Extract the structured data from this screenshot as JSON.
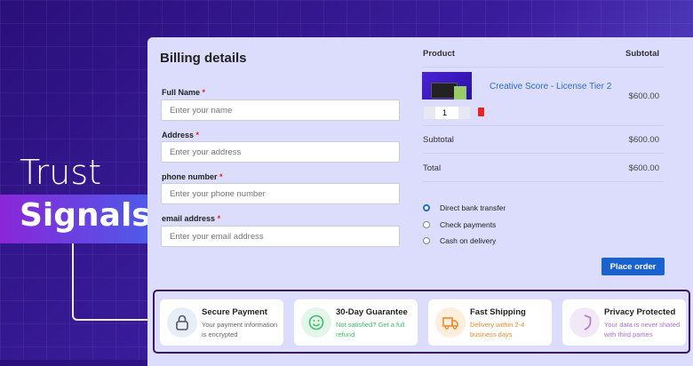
{
  "hero": {
    "line1": "Trust",
    "line2": "Signals"
  },
  "billing": {
    "title": "Billing details",
    "fields": [
      {
        "label": "Full Name",
        "placeholder": "Enter your name"
      },
      {
        "label": "Address",
        "placeholder": "Enter your address"
      },
      {
        "label": "phone number",
        "placeholder": "Enter your phone number"
      },
      {
        "label": "email address",
        "placeholder": "Enter your email address"
      }
    ],
    "required_mark": "*"
  },
  "order": {
    "product_header": "Product",
    "subtotal_header": "Subtotal",
    "product_name": "Creative Score - License Tier 2",
    "product_price": "$600.00",
    "quantity": "1",
    "subtotal_label": "Subtotal",
    "subtotal_value": "$600.00",
    "total_label": "Total",
    "total_value": "$600.00",
    "payment_methods": [
      {
        "label": "Direct bank transfer",
        "selected": true
      },
      {
        "label": "Check payments",
        "selected": false
      },
      {
        "label": "Cash on delivery",
        "selected": false
      }
    ],
    "place_order": "Place order"
  },
  "trust_signals": [
    {
      "icon": "lock-icon",
      "title": "Secure Payment",
      "desc": "Your payment information is encrypted",
      "color": "#555566",
      "bg": "#e8eef8"
    },
    {
      "icon": "smiley-icon",
      "title": "30-Day Guarantee",
      "desc": "Not satisfied? Get a full refund",
      "color": "#3cbf6a",
      "bg": "#e4f6ea"
    },
    {
      "icon": "truck-icon",
      "title": "Fast Shipping",
      "desc": "Delivery within 2-4 business days",
      "color": "#f08a2a",
      "bg": "#fdeedd"
    },
    {
      "icon": "shield-icon",
      "title": "Privacy Protected",
      "desc": "Your data is never shared with third parties",
      "color": "#b070d8",
      "bg": "#f2e8f8"
    }
  ]
}
